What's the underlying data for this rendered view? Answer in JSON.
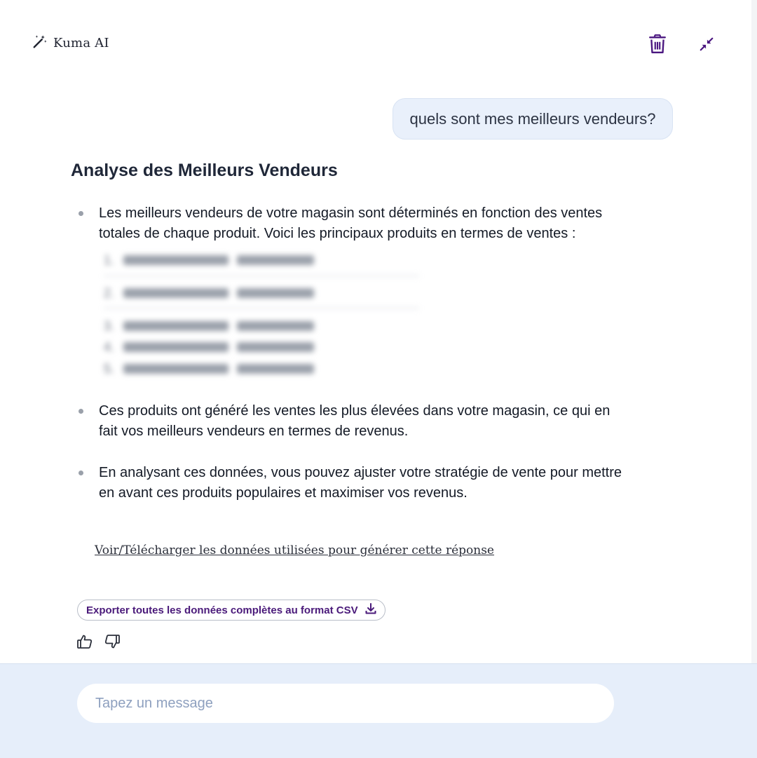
{
  "header": {
    "brand_name": "Kuma AI",
    "brand_icon": "magic-wand-icon",
    "actions": [
      {
        "name": "trash-icon",
        "color": "#4b1780"
      },
      {
        "name": "collapse-icon",
        "color": "#4b1780"
      }
    ]
  },
  "user_message": "quels sont mes meilleurs vendeurs?",
  "answer": {
    "title": "Analyse des Meilleurs Vendeurs",
    "bullets": [
      "Les meilleurs vendeurs de votre magasin sont déterminés en fonction des ventes totales de chaque produit. Voici les principaux produits en termes de ventes :",
      "Ces produits ont généré les ventes les plus élevées dans votre magasin, ce qui en fait vos meilleurs vendeurs en termes de revenus.",
      "En analysant ces données, vous pouvez ajuster votre stratégie de vente pour mettre en avant ces produits populaires et maximiser vos revenus."
    ],
    "blurred_list_numbers": [
      "1.",
      "2.",
      "3.",
      "4.",
      "5."
    ]
  },
  "data_link": "Voir/Télécharger les données utilisées pour générer cette réponse",
  "csv_export": {
    "label": "Exporter toutes les données complètes au format CSV",
    "icon": "download-icon"
  },
  "feedback": {
    "like_icon": "thumbs-up-icon",
    "dislike_icon": "thumbs-down-icon"
  },
  "composer": {
    "placeholder": "Tapez un message"
  },
  "colors": {
    "accent": "#4b1780",
    "user_bubble": "#e9f0fb",
    "composer_bg": "#e6eefa"
  }
}
